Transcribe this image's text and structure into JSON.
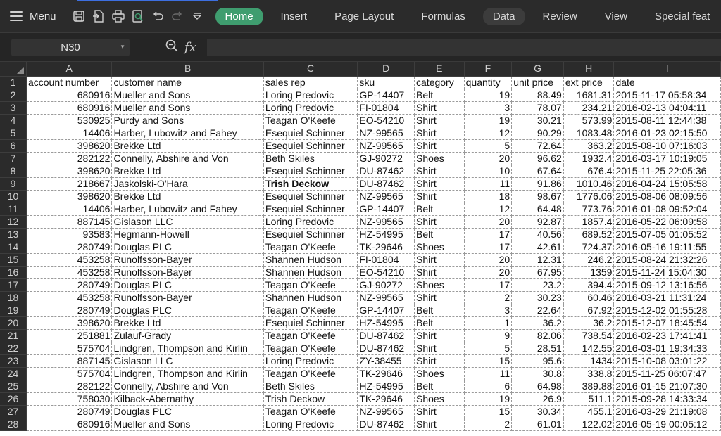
{
  "toolbar": {
    "menu_label": "Menu",
    "quick_access_icons": [
      "save-icon",
      "export-pdf-icon",
      "print-icon",
      "print-preview-icon",
      "undo-icon",
      "redo-icon",
      "customize-dropdown-icon"
    ],
    "tabs": [
      {
        "label": "Home",
        "active": true
      },
      {
        "label": "Insert"
      },
      {
        "label": "Page Layout"
      },
      {
        "label": "Formulas"
      },
      {
        "label": "Data",
        "highlight": true
      },
      {
        "label": "Review"
      },
      {
        "label": "View"
      },
      {
        "label": "Special feat"
      }
    ]
  },
  "formula_bar": {
    "name_box": "N30",
    "fx_label": "fx",
    "formula": ""
  },
  "sheet": {
    "columns": [
      "A",
      "B",
      "C",
      "D",
      "E",
      "F",
      "G",
      "H",
      "I"
    ],
    "rows": [
      {
        "n": "1",
        "cells": [
          "account number",
          "customer name",
          "sales rep",
          "sku",
          "category",
          "quantity",
          "unit price",
          "ext price",
          "date"
        ]
      },
      {
        "n": "2",
        "cells": [
          "680916",
          "Mueller and Sons",
          "Loring Predovic",
          "GP-14407",
          "Belt",
          "19",
          "88.49",
          "1681.31",
          "2015-11-17 05:58:34"
        ]
      },
      {
        "n": "3",
        "cells": [
          "680916",
          "Mueller and Sons",
          "Loring Predovic",
          "FI-01804",
          "Shirt",
          "3",
          "78.07",
          "234.21",
          "2016-02-13 04:04:11"
        ]
      },
      {
        "n": "4",
        "cells": [
          "530925",
          "Purdy and Sons",
          "Teagan O'Keefe",
          "EO-54210",
          "Shirt",
          "19",
          "30.21",
          "573.99",
          "2015-08-11 12:44:38"
        ]
      },
      {
        "n": "5",
        "cells": [
          "14406",
          "Harber, Lubowitz and Fahey",
          "Esequiel Schinner",
          "NZ-99565",
          "Shirt",
          "12",
          "90.29",
          "1083.48",
          "2016-01-23 02:15:50"
        ]
      },
      {
        "n": "6",
        "cells": [
          "398620",
          "Brekke Ltd",
          "Esequiel Schinner",
          "NZ-99565",
          "Shirt",
          "5",
          "72.64",
          "363.2",
          "2015-08-10 07:16:03"
        ]
      },
      {
        "n": "7",
        "cells": [
          "282122",
          "Connelly, Abshire and Von",
          "Beth Skiles",
          "GJ-90272",
          "Shoes",
          "20",
          "96.62",
          "1932.4",
          "2016-03-17 10:19:05"
        ]
      },
      {
        "n": "8",
        "cells": [
          "398620",
          "Brekke Ltd",
          "Esequiel Schinner",
          "DU-87462",
          "Shirt",
          "10",
          "67.64",
          "676.4",
          "2015-11-25 22:05:36"
        ]
      },
      {
        "n": "9",
        "cells": [
          "218667",
          "Jaskolski-O'Hara",
          "Trish Deckow",
          "DU-87462",
          "Shirt",
          "11",
          "91.86",
          "1010.46",
          "2016-04-24 15:05:58"
        ],
        "bold_col": 2
      },
      {
        "n": "10",
        "cells": [
          "398620",
          "Brekke Ltd",
          "Esequiel Schinner",
          "NZ-99565",
          "Shirt",
          "18",
          "98.67",
          "1776.06",
          "2015-08-06 08:09:56"
        ]
      },
      {
        "n": "11",
        "cells": [
          "14406",
          "Harber, Lubowitz and Fahey",
          "Esequiel Schinner",
          "GP-14407",
          "Belt",
          "12",
          "64.48",
          "773.76",
          "2016-01-08 09:52:04"
        ]
      },
      {
        "n": "12",
        "cells": [
          "887145",
          "Gislason LLC",
          "Loring Predovic",
          "NZ-99565",
          "Shirt",
          "20",
          "92.87",
          "1857.4",
          "2016-05-22 06:09:58"
        ]
      },
      {
        "n": "13",
        "cells": [
          "93583",
          "Hegmann-Howell",
          "Esequiel Schinner",
          "HZ-54995",
          "Belt",
          "17",
          "40.56",
          "689.52",
          "2015-07-05 01:05:52"
        ]
      },
      {
        "n": "14",
        "cells": [
          "280749",
          "Douglas PLC",
          "Teagan O'Keefe",
          "TK-29646",
          "Shoes",
          "17",
          "42.61",
          "724.37",
          "2016-05-16 19:11:55"
        ]
      },
      {
        "n": "15",
        "cells": [
          "453258",
          "Runolfsson-Bayer",
          "Shannen Hudson",
          "FI-01804",
          "Shirt",
          "20",
          "12.31",
          "246.2",
          "2015-08-24 21:32:26"
        ]
      },
      {
        "n": "16",
        "cells": [
          "453258",
          "Runolfsson-Bayer",
          "Shannen Hudson",
          "EO-54210",
          "Shirt",
          "20",
          "67.95",
          "1359",
          "2015-11-24 15:04:30"
        ]
      },
      {
        "n": "17",
        "cells": [
          "280749",
          "Douglas PLC",
          "Teagan O'Keefe",
          "GJ-90272",
          "Shoes",
          "17",
          "23.2",
          "394.4",
          "2015-09-12 13:16:56"
        ]
      },
      {
        "n": "18",
        "cells": [
          "453258",
          "Runolfsson-Bayer",
          "Shannen Hudson",
          "NZ-99565",
          "Shirt",
          "2",
          "30.23",
          "60.46",
          "2016-03-21 11:31:24"
        ]
      },
      {
        "n": "19",
        "cells": [
          "280749",
          "Douglas PLC",
          "Teagan O'Keefe",
          "GP-14407",
          "Belt",
          "3",
          "22.64",
          "67.92",
          "2015-12-02 01:55:28"
        ]
      },
      {
        "n": "20",
        "cells": [
          "398620",
          "Brekke Ltd",
          "Esequiel Schinner",
          "HZ-54995",
          "Belt",
          "1",
          "36.2",
          "36.2",
          "2015-12-07 18:45:54"
        ]
      },
      {
        "n": "21",
        "cells": [
          "251881",
          "Zulauf-Grady",
          "Teagan O'Keefe",
          "DU-87462",
          "Shirt",
          "9",
          "82.06",
          "738.54",
          "2016-02-23 17:41:41"
        ]
      },
      {
        "n": "22",
        "cells": [
          "575704",
          "Lindgren, Thompson and Kirlin",
          "Teagan O'Keefe",
          "DU-87462",
          "Shirt",
          "5",
          "28.51",
          "142.55",
          "2016-03-01 19:34:33"
        ]
      },
      {
        "n": "23",
        "cells": [
          "887145",
          "Gislason LLC",
          "Loring Predovic",
          "ZY-38455",
          "Shirt",
          "15",
          "95.6",
          "1434",
          "2015-10-08 03:01:22"
        ]
      },
      {
        "n": "24",
        "cells": [
          "575704",
          "Lindgren, Thompson and Kirlin",
          "Teagan O'Keefe",
          "TK-29646",
          "Shoes",
          "11",
          "30.8",
          "338.8",
          "2015-11-25 06:07:47"
        ]
      },
      {
        "n": "25",
        "cells": [
          "282122",
          "Connelly, Abshire and Von",
          "Beth Skiles",
          "HZ-54995",
          "Belt",
          "6",
          "64.98",
          "389.88",
          "2016-01-15 21:07:30"
        ]
      },
      {
        "n": "26",
        "cells": [
          "758030",
          "Kilback-Abernathy",
          "Trish Deckow",
          "TK-29646",
          "Shoes",
          "19",
          "26.9",
          "511.1",
          "2015-09-28 14:33:34"
        ]
      },
      {
        "n": "27",
        "cells": [
          "280749",
          "Douglas PLC",
          "Teagan O'Keefe",
          "NZ-99565",
          "Shirt",
          "15",
          "30.34",
          "455.1",
          "2016-03-29 21:19:08"
        ]
      },
      {
        "n": "28",
        "cells": [
          "680916",
          "Mueller and Sons",
          "Loring Predovic",
          "DU-87462",
          "Shirt",
          "2",
          "61.01",
          "122.02",
          "2016-05-19 00:05:12"
        ]
      }
    ]
  },
  "colors": {
    "home_tab": "#3f9d6f",
    "toolbar_bg": "#2b2b2b",
    "grid_bg": "#ffffff"
  }
}
